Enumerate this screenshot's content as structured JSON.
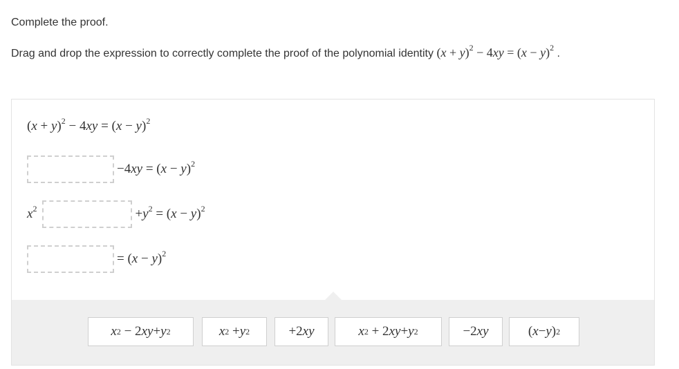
{
  "instructions": {
    "title": "Complete the proof.",
    "prompt": "Drag and drop the expression to correctly complete the proof of the polynomial identity",
    "period": "."
  },
  "proof": {
    "line1_rhs": "(x + y)² − 4xy = (x − y)²",
    "line2_rhs": "−4xy = (x − y)²",
    "line3_prefix": "x²",
    "line3_rhs": "+y² = (x − y)²",
    "line4_rhs": "= (x − y)²"
  },
  "tiles": [
    "x² − 2xy + y²",
    "x² + y²",
    "+2xy",
    "x² + 2xy + y²",
    "−2xy",
    "(x − y)²"
  ]
}
